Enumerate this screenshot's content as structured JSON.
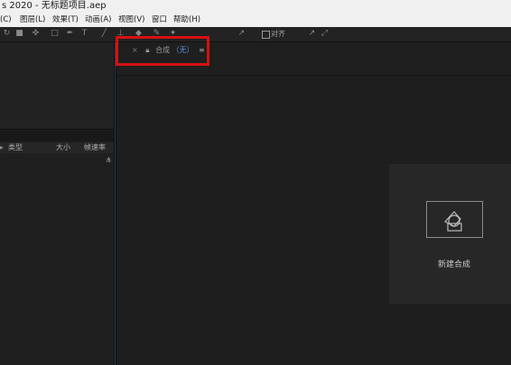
{
  "window": {
    "title": "s 2020 - 无标题项目.aep"
  },
  "menu": {
    "items": [
      "(C)",
      "图层(L)",
      "效果(T)",
      "动画(A)",
      "视图(V)",
      "窗口",
      "帮助(H)"
    ]
  },
  "toolbar": {
    "align_label": "对齐"
  },
  "project_panel": {
    "columns": {
      "type": "类型",
      "size": "大小",
      "fps": "帧速率"
    }
  },
  "composition_panel": {
    "tab_label": "合成",
    "tab_value": "（无）",
    "new_comp_label": "新建合成"
  }
}
